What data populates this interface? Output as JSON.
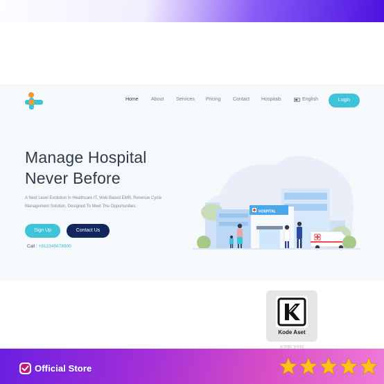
{
  "nav": {
    "items": [
      "Home",
      "About",
      "Services",
      "Pricing",
      "Contact",
      "Hospitals"
    ],
    "language": "English",
    "login_label": "Login"
  },
  "hero": {
    "title_line1": "Manage Hospital",
    "title_line2": "Never Before",
    "subtitle": "A Next Level Evolution In Healthcare IT, Web Based EMR, Revenue Cycle Management Solution, Designed To Meet The Opportunities.",
    "signup_label": "Sign Up",
    "contact_label": "Contact Us",
    "call_label": "Call :",
    "call_number": "+912345678900"
  },
  "illustration": {
    "sign": "HOSPITAL"
  },
  "watermark": {
    "text": "Kode Aset"
  },
  "banner": {
    "official_label": "Official Store",
    "rating_stars": 5
  },
  "colors": {
    "accent": "#3ec3d8",
    "navy": "#12275c",
    "banner_purple": "#6a1fe0",
    "star": "#ffc21a"
  }
}
